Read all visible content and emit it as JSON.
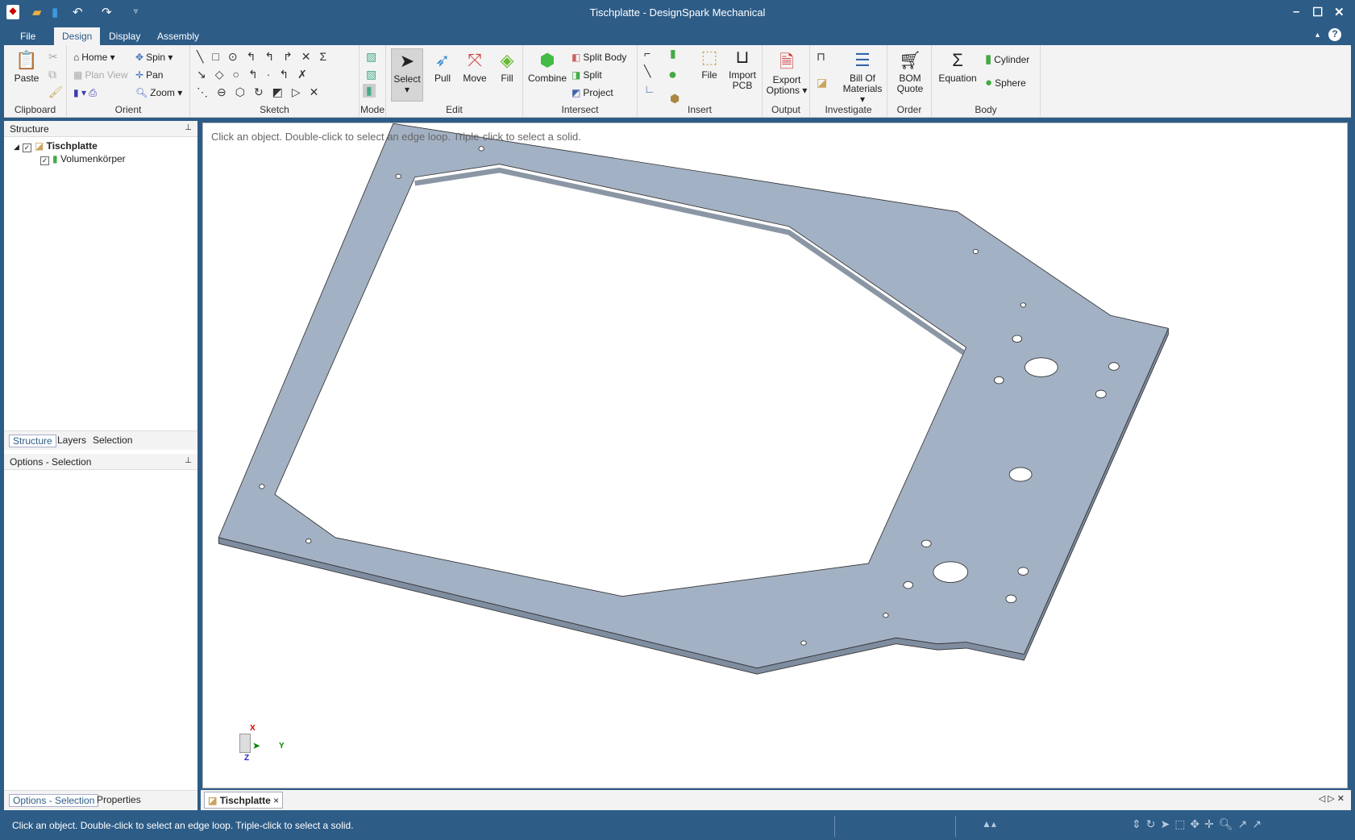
{
  "window": {
    "title": "Tischplatte - DesignSpark Mechanical",
    "minimize": "–",
    "maximize": "☐",
    "close": "✕"
  },
  "quick_access": [
    "app-icon",
    "open-icon",
    "save-icon",
    "undo-icon",
    "redo-icon",
    "customize-icon"
  ],
  "tabs": [
    {
      "label": "File"
    },
    {
      "label": "Design",
      "active": true
    },
    {
      "label": "Display"
    },
    {
      "label": "Assembly"
    }
  ],
  "ribbon": {
    "clipboard": {
      "label": "Clipboard",
      "paste": "Paste"
    },
    "orient": {
      "label": "Orient",
      "home": "Home",
      "spin": "Spin",
      "plan_view": "Plan View",
      "pan": "Pan",
      "zoom": "Zoom"
    },
    "sketch": {
      "label": "Sketch"
    },
    "mode": {
      "label": "Mode"
    },
    "edit": {
      "label": "Edit",
      "select": "Select",
      "pull": "Pull",
      "move": "Move",
      "fill": "Fill"
    },
    "intersect": {
      "label": "Intersect",
      "combine": "Combine",
      "split_body": "Split Body",
      "split": "Split",
      "project": "Project"
    },
    "insert": {
      "label": "Insert",
      "file": "File",
      "import_pcb": "Import PCB"
    },
    "output": {
      "label": "Output",
      "export_options": "Export Options"
    },
    "investigate": {
      "label": "Investigate",
      "bom": "Bill Of Materials"
    },
    "order": {
      "label": "Order",
      "bom_quote": "BOM Quote"
    },
    "body": {
      "label": "Body",
      "equation": "Equation",
      "cylinder": "Cylinder",
      "sphere": "Sphere"
    }
  },
  "structure": {
    "title": "Structure",
    "root": "Tischplatte",
    "child": "Volumenkörper",
    "tabs": [
      "Structure",
      "Layers",
      "Selection"
    ]
  },
  "options": {
    "title": "Options - Selection",
    "tabs": [
      "Options - Selection",
      "Properties"
    ]
  },
  "viewport": {
    "hint": "Click an object. Double-click to select an edge loop. Triple-click to select a solid.",
    "axes": {
      "x": "X",
      "y": "Y",
      "z": "Z"
    },
    "plate_color": "#a3b1c4"
  },
  "doc_tab": {
    "label": "Tischplatte"
  },
  "status": {
    "text": "Click an object. Double-click to select an edge loop. Triple-click to select a solid."
  }
}
